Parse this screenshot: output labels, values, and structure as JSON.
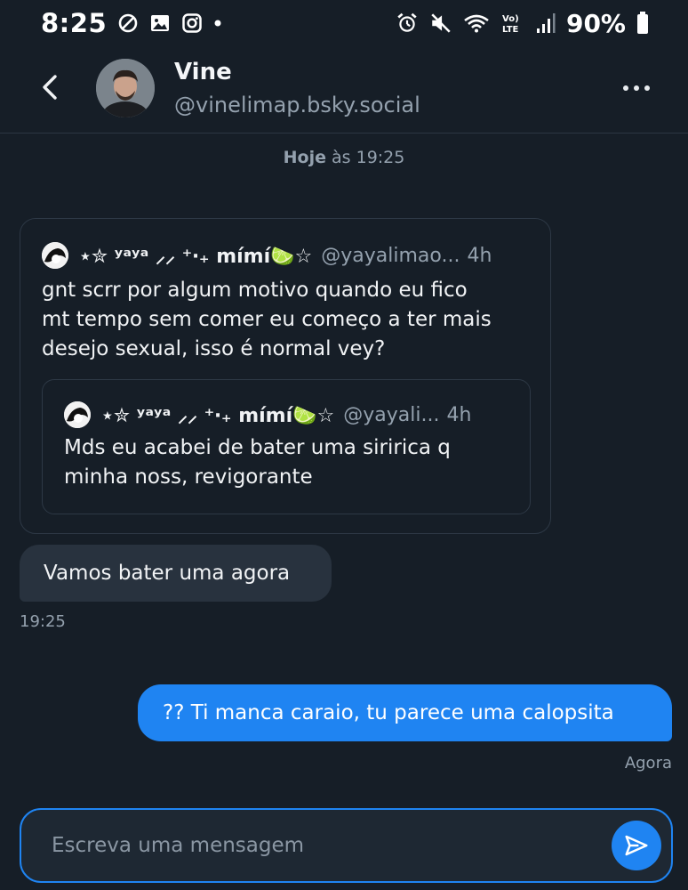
{
  "status_bar": {
    "time": "8:25",
    "battery": "90%",
    "left_icons": [
      "do-not-disturb-icon",
      "gallery-icon",
      "instagram-icon",
      "dot-icon"
    ],
    "right_icons": [
      "alarm-icon",
      "mute-icon",
      "wifi-icon",
      "volte-icon",
      "signal-icon",
      "battery-icon"
    ]
  },
  "header": {
    "name": "Vine",
    "handle": "@vinelimap.bsky.social"
  },
  "date_separator": {
    "day": "Hoje",
    "rest": " às 19:25"
  },
  "embed_post": {
    "author": "⋆✮ ʸᵃʸᵃ ⸝⸝ ⁺‧₊ mímí🍋‍🟩☆",
    "handle": "@yayalimao...",
    "time": "4h",
    "text_lines": [
      "gnt scrr por algum motivo quando eu fico",
      "mt tempo sem comer eu começo a ter mais",
      "desejo sexual, isso é normal vey?"
    ],
    "quote": {
      "author": "⋆✮ ʸᵃʸᵃ ⸝⸝ ⁺‧₊ mímí🍋‍🟩☆",
      "handle": "@yayali...",
      "time": "4h",
      "text_lines": [
        "Mds eu acabei de bater uma siririca q",
        "minha noss, revigorante"
      ]
    }
  },
  "messages": [
    {
      "direction": "received",
      "text": "Vamos bater uma agora",
      "time": "19:25"
    },
    {
      "direction": "sent",
      "text": "?? Ti manca caraio, tu parece uma calopsita",
      "time": "Agora"
    }
  ],
  "composer": {
    "placeholder": "Escreva uma mensagem",
    "value": ""
  },
  "colors": {
    "background": "#161e27",
    "accent": "#1f84f2",
    "bubble_received": "#28323e",
    "muted_text": "#94a1ae"
  }
}
